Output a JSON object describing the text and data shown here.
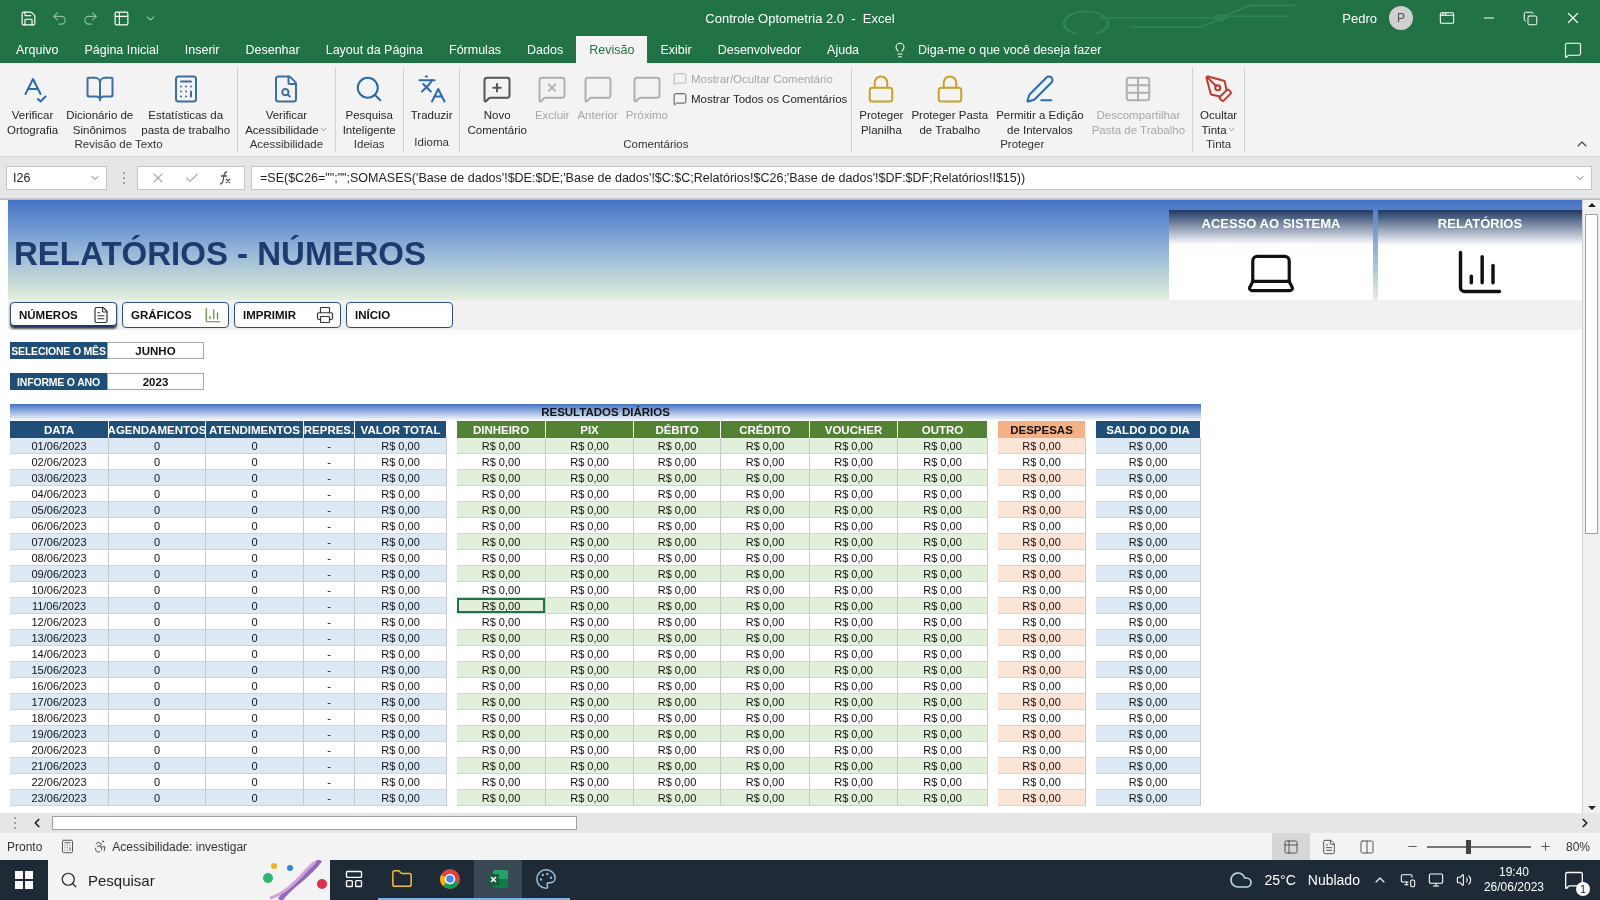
{
  "title_bar": {
    "title": "Controle Optometria 2.0  -  Excel",
    "user": "Pedro",
    "avatar": "P"
  },
  "menu_tabs": [
    {
      "label": "Arquivo",
      "selected": false
    },
    {
      "label": "Página Inicial",
      "selected": false
    },
    {
      "label": "Inserir",
      "selected": false
    },
    {
      "label": "Desenhar",
      "selected": false
    },
    {
      "label": "Layout da Página",
      "selected": false
    },
    {
      "label": "Fórmulas",
      "selected": false
    },
    {
      "label": "Dados",
      "selected": false
    },
    {
      "label": "Revisão",
      "selected": true
    },
    {
      "label": "Exibir",
      "selected": false
    },
    {
      "label": "Desenvolvedor",
      "selected": false
    },
    {
      "label": "Ajuda",
      "selected": false
    }
  ],
  "tell_me": "Diga-me o que você deseja fazer",
  "ribbon": {
    "groups": [
      {
        "label": "Revisão de Texto",
        "buttons": [
          {
            "kind": "large",
            "lines": [
              "Verificar",
              "Ortografia"
            ],
            "disabled": false,
            "dropdown": false
          },
          {
            "kind": "large",
            "lines": [
              "Dicionário de",
              "Sinônimos"
            ],
            "disabled": false,
            "dropdown": false
          },
          {
            "kind": "large",
            "lines": [
              "Estatísticas da",
              "pasta de trabalho"
            ],
            "disabled": false,
            "dropdown": false
          }
        ]
      },
      {
        "label": "Acessibilidade",
        "buttons": [
          {
            "kind": "large",
            "lines": [
              "Verificar",
              "Acessibilidade"
            ],
            "disabled": false,
            "dropdown": true
          }
        ]
      },
      {
        "label": "Ideias",
        "buttons": [
          {
            "kind": "large",
            "lines": [
              "Pesquisa",
              "Inteligente"
            ],
            "disabled": false,
            "dropdown": false
          }
        ]
      },
      {
        "label": "Idioma",
        "buttons": [
          {
            "kind": "large",
            "lines": [
              "Traduzir"
            ],
            "disabled": false,
            "dropdown": false
          }
        ]
      },
      {
        "label": "Comentários",
        "buttons": [
          {
            "kind": "large",
            "lines": [
              "Novo",
              "Comentário"
            ],
            "disabled": false,
            "dropdown": false
          },
          {
            "kind": "large",
            "lines": [
              "Excluir"
            ],
            "disabled": true,
            "dropdown": false
          },
          {
            "kind": "large",
            "lines": [
              "Anterior"
            ],
            "disabled": true,
            "dropdown": false
          },
          {
            "kind": "large",
            "lines": [
              "Próximo"
            ],
            "disabled": true,
            "dropdown": false
          },
          {
            "kind": "small",
            "lines": [
              "Mostrar/Ocultar Comentário"
            ],
            "disabled": true,
            "dropdown": false
          },
          {
            "kind": "small",
            "lines": [
              "Mostrar Todos os Comentários"
            ],
            "disabled": false,
            "dropdown": false
          }
        ]
      },
      {
        "label": "Proteger",
        "buttons": [
          {
            "kind": "large",
            "lines": [
              "Proteger",
              "Planilha"
            ],
            "disabled": false,
            "dropdown": false
          },
          {
            "kind": "large",
            "lines": [
              "Proteger Pasta",
              "de Trabalho"
            ],
            "disabled": false,
            "dropdown": false
          },
          {
            "kind": "large",
            "lines": [
              "Permitir a Edição",
              "de Intervalos"
            ],
            "disabled": false,
            "dropdown": false
          },
          {
            "kind": "large",
            "lines": [
              "Descompartilhar",
              "Pasta de Trabalho"
            ],
            "disabled": true,
            "dropdown": false
          }
        ]
      },
      {
        "label": "Tinta",
        "buttons": [
          {
            "kind": "large",
            "lines": [
              "Ocultar",
              "Tinta"
            ],
            "disabled": false,
            "dropdown": true
          }
        ]
      }
    ]
  },
  "formula_bar": {
    "name_box": "I26",
    "formula": "=SE($C26=\"\";\"\";SOMASES('Base de dados'!$DE:$DE;'Base de dados'!$C:$C;Relatórios!$C26;'Base de dados'!$DF:$DF;Relatórios!I$15))"
  },
  "sheet": {
    "title": "RELATÓRIOS - NÚMEROS",
    "nav_buttons": [
      {
        "label": "NÚMEROS",
        "selected": true
      },
      {
        "label": "GRÁFICOS",
        "selected": false
      },
      {
        "label": "IMPRIMIR",
        "selected": false
      },
      {
        "label": "INÍCIO",
        "selected": false
      }
    ],
    "cards": [
      {
        "title": "ACESSO AO SISTEMA"
      },
      {
        "title": "RELATÓRIOS"
      }
    ],
    "fields": [
      {
        "label": "SELECIONE O MÊS",
        "value": "JUNHO"
      },
      {
        "label": "INFORME O ANO",
        "value": "2023"
      }
    ],
    "table": {
      "title": "RESULTADOS DIÁRIOS",
      "groups": [
        {
          "kind": "atendimento",
          "color": "#1f4e79",
          "columns": [
            "DATA",
            "AGENDAMENTOS",
            "ATENDIMENTOS",
            "REPRES.",
            "VALOR TOTAL"
          ]
        },
        {
          "kind": "pagamento",
          "color": "#548235",
          "columns": [
            "DINHEIRO",
            "PIX",
            "DÉBITO",
            "CRÉDITO",
            "VOUCHER",
            "OUTRO"
          ]
        },
        {
          "kind": "despesa",
          "color": "#f4b183",
          "columns": [
            "DESPESAS"
          ]
        },
        {
          "kind": "saldo",
          "color": "#1f4e79",
          "columns": [
            "SALDO DO DIA"
          ]
        }
      ],
      "rows": [
        {
          "cells": [
            {
              "text": "01/06/2023",
              "selected": false
            },
            {
              "text": "0",
              "selected": false
            },
            {
              "text": "0",
              "selected": false
            },
            {
              "text": "-",
              "selected": false
            },
            {
              "text": "R$ 0,00",
              "selected": false
            },
            {
              "text": "R$ 0,00",
              "selected": false
            },
            {
              "text": "R$ 0,00",
              "selected": false
            },
            {
              "text": "R$ 0,00",
              "selected": false
            },
            {
              "text": "R$ 0,00",
              "selected": false
            },
            {
              "text": "R$ 0,00",
              "selected": false
            },
            {
              "text": "R$ 0,00",
              "selected": false
            },
            {
              "text": "R$ 0,00",
              "selected": false
            },
            {
              "text": "R$ 0,00",
              "selected": false
            }
          ]
        },
        {
          "cells": [
            {
              "text": "02/06/2023",
              "selected": false
            },
            {
              "text": "0",
              "selected": false
            },
            {
              "text": "0",
              "selected": false
            },
            {
              "text": "-",
              "selected": false
            },
            {
              "text": "R$ 0,00",
              "selected": false
            },
            {
              "text": "R$ 0,00",
              "selected": false
            },
            {
              "text": "R$ 0,00",
              "selected": false
            },
            {
              "text": "R$ 0,00",
              "selected": false
            },
            {
              "text": "R$ 0,00",
              "selected": false
            },
            {
              "text": "R$ 0,00",
              "selected": false
            },
            {
              "text": "R$ 0,00",
              "selected": false
            },
            {
              "text": "R$ 0,00",
              "selected": false
            },
            {
              "text": "R$ 0,00",
              "selected": false
            }
          ]
        },
        {
          "cells": [
            {
              "text": "03/06/2023",
              "selected": false
            },
            {
              "text": "0",
              "selected": false
            },
            {
              "text": "0",
              "selected": false
            },
            {
              "text": "-",
              "selected": false
            },
            {
              "text": "R$ 0,00",
              "selected": false
            },
            {
              "text": "R$ 0,00",
              "selected": false
            },
            {
              "text": "R$ 0,00",
              "selected": false
            },
            {
              "text": "R$ 0,00",
              "selected": false
            },
            {
              "text": "R$ 0,00",
              "selected": false
            },
            {
              "text": "R$ 0,00",
              "selected": false
            },
            {
              "text": "R$ 0,00",
              "selected": false
            },
            {
              "text": "R$ 0,00",
              "selected": false
            },
            {
              "text": "R$ 0,00",
              "selected": false
            }
          ]
        },
        {
          "cells": [
            {
              "text": "04/06/2023",
              "selected": false
            },
            {
              "text": "0",
              "selected": false
            },
            {
              "text": "0",
              "selected": false
            },
            {
              "text": "-",
              "selected": false
            },
            {
              "text": "R$ 0,00",
              "selected": false
            },
            {
              "text": "R$ 0,00",
              "selected": false
            },
            {
              "text": "R$ 0,00",
              "selected": false
            },
            {
              "text": "R$ 0,00",
              "selected": false
            },
            {
              "text": "R$ 0,00",
              "selected": false
            },
            {
              "text": "R$ 0,00",
              "selected": false
            },
            {
              "text": "R$ 0,00",
              "selected": false
            },
            {
              "text": "R$ 0,00",
              "selected": false
            },
            {
              "text": "R$ 0,00",
              "selected": false
            }
          ]
        },
        {
          "cells": [
            {
              "text": "05/06/2023",
              "selected": false
            },
            {
              "text": "0",
              "selected": false
            },
            {
              "text": "0",
              "selected": false
            },
            {
              "text": "-",
              "selected": false
            },
            {
              "text": "R$ 0,00",
              "selected": false
            },
            {
              "text": "R$ 0,00",
              "selected": false
            },
            {
              "text": "R$ 0,00",
              "selected": false
            },
            {
              "text": "R$ 0,00",
              "selected": false
            },
            {
              "text": "R$ 0,00",
              "selected": false
            },
            {
              "text": "R$ 0,00",
              "selected": false
            },
            {
              "text": "R$ 0,00",
              "selected": false
            },
            {
              "text": "R$ 0,00",
              "selected": false
            },
            {
              "text": "R$ 0,00",
              "selected": false
            }
          ]
        },
        {
          "cells": [
            {
              "text": "06/06/2023",
              "selected": false
            },
            {
              "text": "0",
              "selected": false
            },
            {
              "text": "0",
              "selected": false
            },
            {
              "text": "-",
              "selected": false
            },
            {
              "text": "R$ 0,00",
              "selected": false
            },
            {
              "text": "R$ 0,00",
              "selected": false
            },
            {
              "text": "R$ 0,00",
              "selected": false
            },
            {
              "text": "R$ 0,00",
              "selected": false
            },
            {
              "text": "R$ 0,00",
              "selected": false
            },
            {
              "text": "R$ 0,00",
              "selected": false
            },
            {
              "text": "R$ 0,00",
              "selected": false
            },
            {
              "text": "R$ 0,00",
              "selected": false
            },
            {
              "text": "R$ 0,00",
              "selected": false
            }
          ]
        },
        {
          "cells": [
            {
              "text": "07/06/2023",
              "selected": false
            },
            {
              "text": "0",
              "selected": false
            },
            {
              "text": "0",
              "selected": false
            },
            {
              "text": "-",
              "selected": false
            },
            {
              "text": "R$ 0,00",
              "selected": false
            },
            {
              "text": "R$ 0,00",
              "selected": false
            },
            {
              "text": "R$ 0,00",
              "selected": false
            },
            {
              "text": "R$ 0,00",
              "selected": false
            },
            {
              "text": "R$ 0,00",
              "selected": false
            },
            {
              "text": "R$ 0,00",
              "selected": false
            },
            {
              "text": "R$ 0,00",
              "selected": false
            },
            {
              "text": "R$ 0,00",
              "selected": false
            },
            {
              "text": "R$ 0,00",
              "selected": false
            }
          ]
        },
        {
          "cells": [
            {
              "text": "08/06/2023",
              "selected": false
            },
            {
              "text": "0",
              "selected": false
            },
            {
              "text": "0",
              "selected": false
            },
            {
              "text": "-",
              "selected": false
            },
            {
              "text": "R$ 0,00",
              "selected": false
            },
            {
              "text": "R$ 0,00",
              "selected": false
            },
            {
              "text": "R$ 0,00",
              "selected": false
            },
            {
              "text": "R$ 0,00",
              "selected": false
            },
            {
              "text": "R$ 0,00",
              "selected": false
            },
            {
              "text": "R$ 0,00",
              "selected": false
            },
            {
              "text": "R$ 0,00",
              "selected": false
            },
            {
              "text": "R$ 0,00",
              "selected": false
            },
            {
              "text": "R$ 0,00",
              "selected": false
            }
          ]
        },
        {
          "cells": [
            {
              "text": "09/06/2023",
              "selected": false
            },
            {
              "text": "0",
              "selected": false
            },
            {
              "text": "0",
              "selected": false
            },
            {
              "text": "-",
              "selected": false
            },
            {
              "text": "R$ 0,00",
              "selected": false
            },
            {
              "text": "R$ 0,00",
              "selected": false
            },
            {
              "text": "R$ 0,00",
              "selected": false
            },
            {
              "text": "R$ 0,00",
              "selected": false
            },
            {
              "text": "R$ 0,00",
              "selected": false
            },
            {
              "text": "R$ 0,00",
              "selected": false
            },
            {
              "text": "R$ 0,00",
              "selected": false
            },
            {
              "text": "R$ 0,00",
              "selected": false
            },
            {
              "text": "R$ 0,00",
              "selected": false
            }
          ]
        },
        {
          "cells": [
            {
              "text": "10/06/2023",
              "selected": false
            },
            {
              "text": "0",
              "selected": false
            },
            {
              "text": "0",
              "selected": false
            },
            {
              "text": "-",
              "selected": false
            },
            {
              "text": "R$ 0,00",
              "selected": false
            },
            {
              "text": "R$ 0,00",
              "selected": false
            },
            {
              "text": "R$ 0,00",
              "selected": false
            },
            {
              "text": "R$ 0,00",
              "selected": false
            },
            {
              "text": "R$ 0,00",
              "selected": false
            },
            {
              "text": "R$ 0,00",
              "selected": false
            },
            {
              "text": "R$ 0,00",
              "selected": false
            },
            {
              "text": "R$ 0,00",
              "selected": false
            },
            {
              "text": "R$ 0,00",
              "selected": false
            }
          ]
        },
        {
          "cells": [
            {
              "text": "11/06/2023",
              "selected": false
            },
            {
              "text": "0",
              "selected": false
            },
            {
              "text": "0",
              "selected": false
            },
            {
              "text": "-",
              "selected": false
            },
            {
              "text": "R$ 0,00",
              "selected": false
            },
            {
              "text": "R$ 0,00",
              "selected": true
            },
            {
              "text": "R$ 0,00",
              "selected": false
            },
            {
              "text": "R$ 0,00",
              "selected": false
            },
            {
              "text": "R$ 0,00",
              "selected": false
            },
            {
              "text": "R$ 0,00",
              "selected": false
            },
            {
              "text": "R$ 0,00",
              "selected": false
            },
            {
              "text": "R$ 0,00",
              "selected": false
            },
            {
              "text": "R$ 0,00",
              "selected": false
            }
          ]
        },
        {
          "cells": [
            {
              "text": "12/06/2023",
              "selected": false
            },
            {
              "text": "0",
              "selected": false
            },
            {
              "text": "0",
              "selected": false
            },
            {
              "text": "-",
              "selected": false
            },
            {
              "text": "R$ 0,00",
              "selected": false
            },
            {
              "text": "R$ 0,00",
              "selected": false
            },
            {
              "text": "R$ 0,00",
              "selected": false
            },
            {
              "text": "R$ 0,00",
              "selected": false
            },
            {
              "text": "R$ 0,00",
              "selected": false
            },
            {
              "text": "R$ 0,00",
              "selected": false
            },
            {
              "text": "R$ 0,00",
              "selected": false
            },
            {
              "text": "R$ 0,00",
              "selected": false
            },
            {
              "text": "R$ 0,00",
              "selected": false
            }
          ]
        },
        {
          "cells": [
            {
              "text": "13/06/2023",
              "selected": false
            },
            {
              "text": "0",
              "selected": false
            },
            {
              "text": "0",
              "selected": false
            },
            {
              "text": "-",
              "selected": false
            },
            {
              "text": "R$ 0,00",
              "selected": false
            },
            {
              "text": "R$ 0,00",
              "selected": false
            },
            {
              "text": "R$ 0,00",
              "selected": false
            },
            {
              "text": "R$ 0,00",
              "selected": false
            },
            {
              "text": "R$ 0,00",
              "selected": false
            },
            {
              "text": "R$ 0,00",
              "selected": false
            },
            {
              "text": "R$ 0,00",
              "selected": false
            },
            {
              "text": "R$ 0,00",
              "selected": false
            },
            {
              "text": "R$ 0,00",
              "selected": false
            }
          ]
        },
        {
          "cells": [
            {
              "text": "14/06/2023",
              "selected": false
            },
            {
              "text": "0",
              "selected": false
            },
            {
              "text": "0",
              "selected": false
            },
            {
              "text": "-",
              "selected": false
            },
            {
              "text": "R$ 0,00",
              "selected": false
            },
            {
              "text": "R$ 0,00",
              "selected": false
            },
            {
              "text": "R$ 0,00",
              "selected": false
            },
            {
              "text": "R$ 0,00",
              "selected": false
            },
            {
              "text": "R$ 0,00",
              "selected": false
            },
            {
              "text": "R$ 0,00",
              "selected": false
            },
            {
              "text": "R$ 0,00",
              "selected": false
            },
            {
              "text": "R$ 0,00",
              "selected": false
            },
            {
              "text": "R$ 0,00",
              "selected": false
            }
          ]
        },
        {
          "cells": [
            {
              "text": "15/06/2023",
              "selected": false
            },
            {
              "text": "0",
              "selected": false
            },
            {
              "text": "0",
              "selected": false
            },
            {
              "text": "-",
              "selected": false
            },
            {
              "text": "R$ 0,00",
              "selected": false
            },
            {
              "text": "R$ 0,00",
              "selected": false
            },
            {
              "text": "R$ 0,00",
              "selected": false
            },
            {
              "text": "R$ 0,00",
              "selected": false
            },
            {
              "text": "R$ 0,00",
              "selected": false
            },
            {
              "text": "R$ 0,00",
              "selected": false
            },
            {
              "text": "R$ 0,00",
              "selected": false
            },
            {
              "text": "R$ 0,00",
              "selected": false
            },
            {
              "text": "R$ 0,00",
              "selected": false
            }
          ]
        },
        {
          "cells": [
            {
              "text": "16/06/2023",
              "selected": false
            },
            {
              "text": "0",
              "selected": false
            },
            {
              "text": "0",
              "selected": false
            },
            {
              "text": "-",
              "selected": false
            },
            {
              "text": "R$ 0,00",
              "selected": false
            },
            {
              "text": "R$ 0,00",
              "selected": false
            },
            {
              "text": "R$ 0,00",
              "selected": false
            },
            {
              "text": "R$ 0,00",
              "selected": false
            },
            {
              "text": "R$ 0,00",
              "selected": false
            },
            {
              "text": "R$ 0,00",
              "selected": false
            },
            {
              "text": "R$ 0,00",
              "selected": false
            },
            {
              "text": "R$ 0,00",
              "selected": false
            },
            {
              "text": "R$ 0,00",
              "selected": false
            }
          ]
        },
        {
          "cells": [
            {
              "text": "17/06/2023",
              "selected": false
            },
            {
              "text": "0",
              "selected": false
            },
            {
              "text": "0",
              "selected": false
            },
            {
              "text": "-",
              "selected": false
            },
            {
              "text": "R$ 0,00",
              "selected": false
            },
            {
              "text": "R$ 0,00",
              "selected": false
            },
            {
              "text": "R$ 0,00",
              "selected": false
            },
            {
              "text": "R$ 0,00",
              "selected": false
            },
            {
              "text": "R$ 0,00",
              "selected": false
            },
            {
              "text": "R$ 0,00",
              "selected": false
            },
            {
              "text": "R$ 0,00",
              "selected": false
            },
            {
              "text": "R$ 0,00",
              "selected": false
            },
            {
              "text": "R$ 0,00",
              "selected": false
            }
          ]
        },
        {
          "cells": [
            {
              "text": "18/06/2023",
              "selected": false
            },
            {
              "text": "0",
              "selected": false
            },
            {
              "text": "0",
              "selected": false
            },
            {
              "text": "-",
              "selected": false
            },
            {
              "text": "R$ 0,00",
              "selected": false
            },
            {
              "text": "R$ 0,00",
              "selected": false
            },
            {
              "text": "R$ 0,00",
              "selected": false
            },
            {
              "text": "R$ 0,00",
              "selected": false
            },
            {
              "text": "R$ 0,00",
              "selected": false
            },
            {
              "text": "R$ 0,00",
              "selected": false
            },
            {
              "text": "R$ 0,00",
              "selected": false
            },
            {
              "text": "R$ 0,00",
              "selected": false
            },
            {
              "text": "R$ 0,00",
              "selected": false
            }
          ]
        },
        {
          "cells": [
            {
              "text": "19/06/2023",
              "selected": false
            },
            {
              "text": "0",
              "selected": false
            },
            {
              "text": "0",
              "selected": false
            },
            {
              "text": "-",
              "selected": false
            },
            {
              "text": "R$ 0,00",
              "selected": false
            },
            {
              "text": "R$ 0,00",
              "selected": false
            },
            {
              "text": "R$ 0,00",
              "selected": false
            },
            {
              "text": "R$ 0,00",
              "selected": false
            },
            {
              "text": "R$ 0,00",
              "selected": false
            },
            {
              "text": "R$ 0,00",
              "selected": false
            },
            {
              "text": "R$ 0,00",
              "selected": false
            },
            {
              "text": "R$ 0,00",
              "selected": false
            },
            {
              "text": "R$ 0,00",
              "selected": false
            }
          ]
        },
        {
          "cells": [
            {
              "text": "20/06/2023",
              "selected": false
            },
            {
              "text": "0",
              "selected": false
            },
            {
              "text": "0",
              "selected": false
            },
            {
              "text": "-",
              "selected": false
            },
            {
              "text": "R$ 0,00",
              "selected": false
            },
            {
              "text": "R$ 0,00",
              "selected": false
            },
            {
              "text": "R$ 0,00",
              "selected": false
            },
            {
              "text": "R$ 0,00",
              "selected": false
            },
            {
              "text": "R$ 0,00",
              "selected": false
            },
            {
              "text": "R$ 0,00",
              "selected": false
            },
            {
              "text": "R$ 0,00",
              "selected": false
            },
            {
              "text": "R$ 0,00",
              "selected": false
            },
            {
              "text": "R$ 0,00",
              "selected": false
            }
          ]
        },
        {
          "cells": [
            {
              "text": "21/06/2023",
              "selected": false
            },
            {
              "text": "0",
              "selected": false
            },
            {
              "text": "0",
              "selected": false
            },
            {
              "text": "-",
              "selected": false
            },
            {
              "text": "R$ 0,00",
              "selected": false
            },
            {
              "text": "R$ 0,00",
              "selected": false
            },
            {
              "text": "R$ 0,00",
              "selected": false
            },
            {
              "text": "R$ 0,00",
              "selected": false
            },
            {
              "text": "R$ 0,00",
              "selected": false
            },
            {
              "text": "R$ 0,00",
              "selected": false
            },
            {
              "text": "R$ 0,00",
              "selected": false
            },
            {
              "text": "R$ 0,00",
              "selected": false
            },
            {
              "text": "R$ 0,00",
              "selected": false
            }
          ]
        },
        {
          "cells": [
            {
              "text": "22/06/2023",
              "selected": false
            },
            {
              "text": "0",
              "selected": false
            },
            {
              "text": "0",
              "selected": false
            },
            {
              "text": "-",
              "selected": false
            },
            {
              "text": "R$ 0,00",
              "selected": false
            },
            {
              "text": "R$ 0,00",
              "selected": false
            },
            {
              "text": "R$ 0,00",
              "selected": false
            },
            {
              "text": "R$ 0,00",
              "selected": false
            },
            {
              "text": "R$ 0,00",
              "selected": false
            },
            {
              "text": "R$ 0,00",
              "selected": false
            },
            {
              "text": "R$ 0,00",
              "selected": false
            },
            {
              "text": "R$ 0,00",
              "selected": false
            },
            {
              "text": "R$ 0,00",
              "selected": false
            }
          ]
        },
        {
          "cells": [
            {
              "text": "23/06/2023",
              "selected": false
            },
            {
              "text": "0",
              "selected": false
            },
            {
              "text": "0",
              "selected": false
            },
            {
              "text": "-",
              "selected": false
            },
            {
              "text": "R$ 0,00",
              "selected": false
            },
            {
              "text": "R$ 0,00",
              "selected": false
            },
            {
              "text": "R$ 0,00",
              "selected": false
            },
            {
              "text": "R$ 0,00",
              "selected": false
            },
            {
              "text": "R$ 0,00",
              "selected": false
            },
            {
              "text": "R$ 0,00",
              "selected": false
            },
            {
              "text": "R$ 0,00",
              "selected": false
            },
            {
              "text": "R$ 0,00",
              "selected": false
            },
            {
              "text": "R$ 0,00",
              "selected": false
            }
          ]
        }
      ]
    }
  },
  "status_bar": {
    "status": "Pronto",
    "accessibility": "Acessibilidade: investigar",
    "views": [
      {
        "selected": true
      },
      {
        "selected": false
      },
      {
        "selected": false
      }
    ],
    "zoom": {
      "level": 0.38,
      "label": "80%"
    }
  },
  "taskbar": {
    "search": "Pesquisar",
    "temperature": "25°C",
    "condition": "Nublado",
    "time": "19:40",
    "date": "26/06/2023",
    "notifications": "1"
  }
}
